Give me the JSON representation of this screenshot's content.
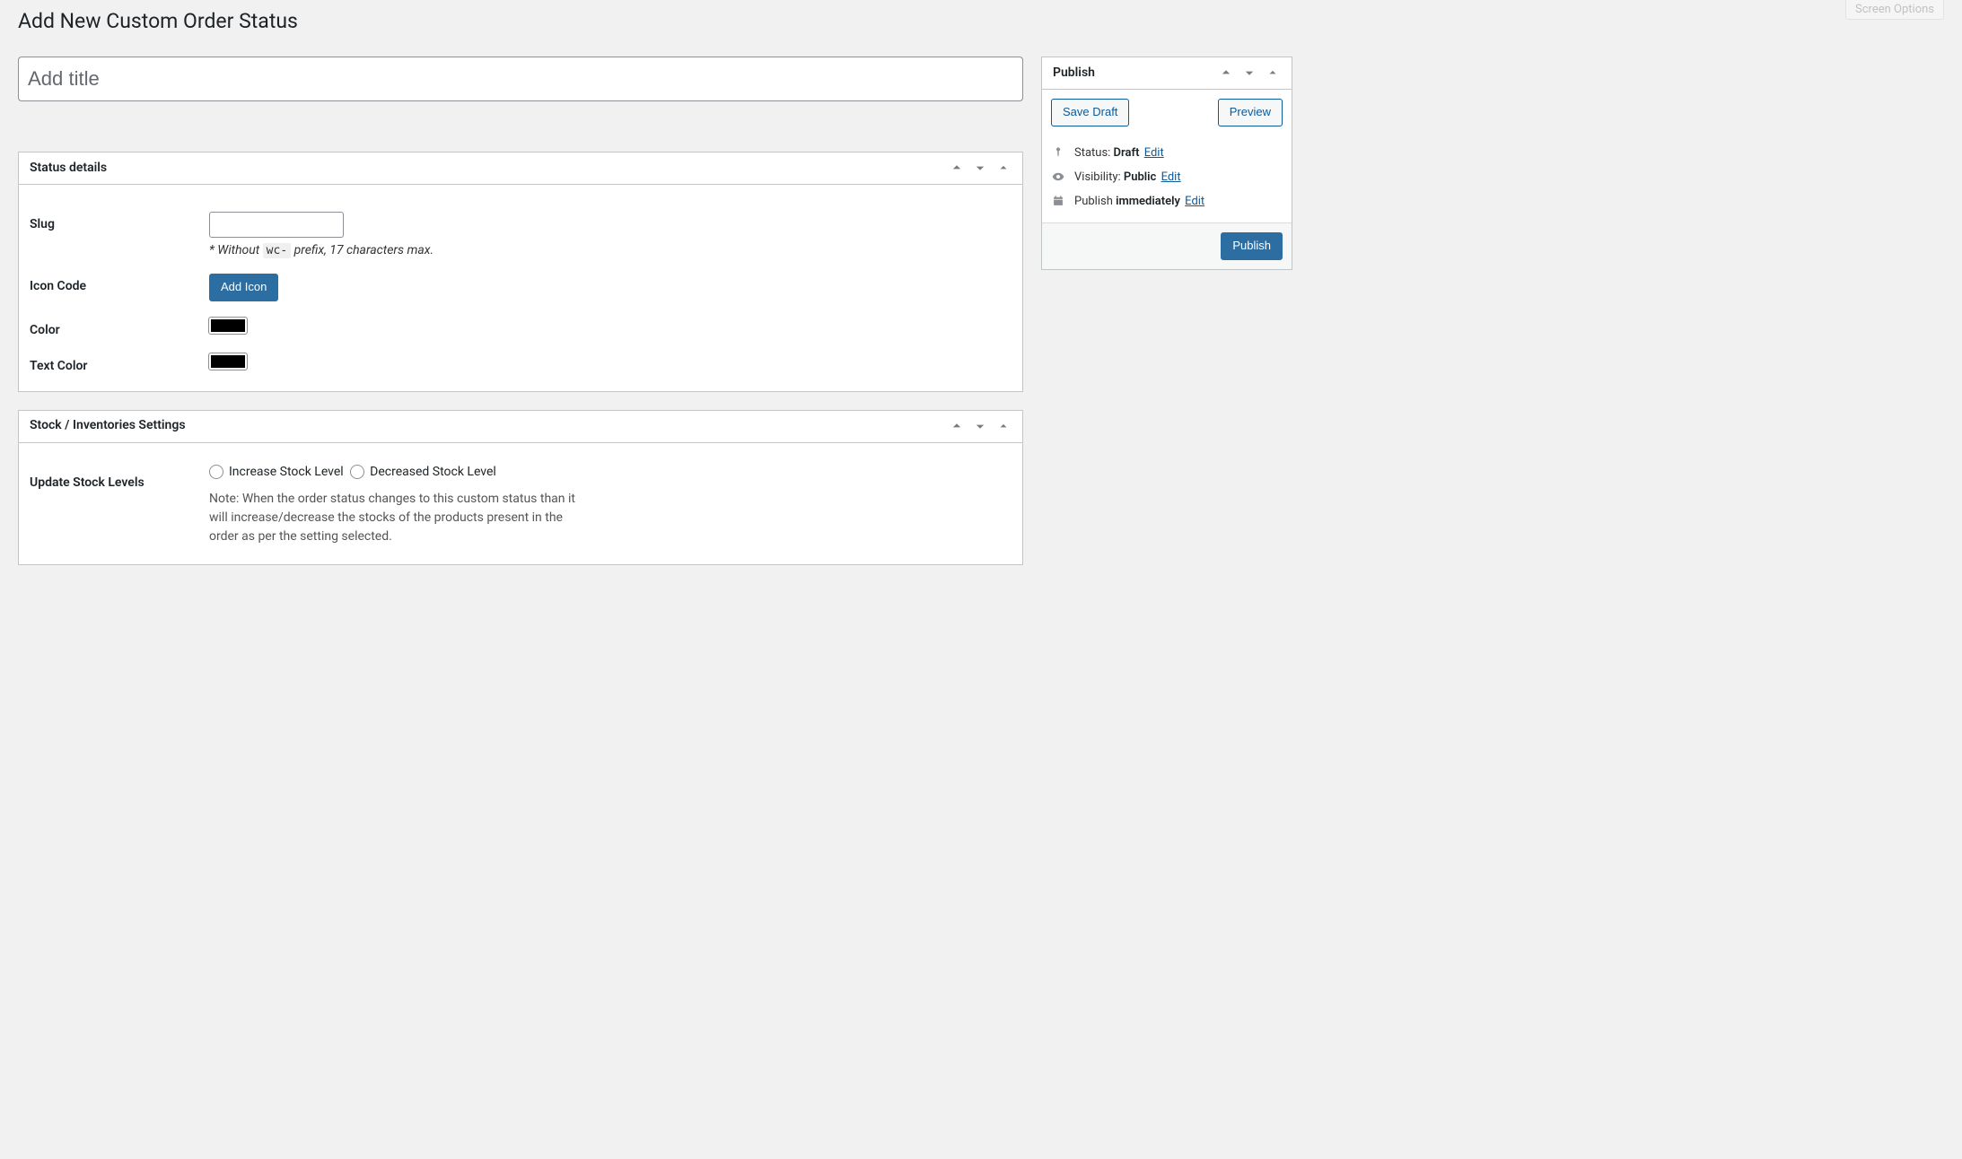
{
  "screen_options": {
    "label": "Screen Options"
  },
  "page": {
    "title": "Add New Custom Order Status"
  },
  "title_input": {
    "placeholder": "Add title",
    "value": ""
  },
  "status_details": {
    "heading": "Status details",
    "slug": {
      "label": "Slug",
      "value": "",
      "hint_prefix": "* Without ",
      "hint_code": "wc-",
      "hint_suffix": " prefix, 17 characters max."
    },
    "icon_code": {
      "label": "Icon Code",
      "button": "Add Icon"
    },
    "color": {
      "label": "Color",
      "value": "#000000"
    },
    "text_color": {
      "label": "Text Color",
      "value": "#000000"
    }
  },
  "stock": {
    "heading": "Stock / Inventories Settings",
    "update_levels": {
      "label": "Update Stock Levels",
      "option_increase": "Increase Stock Level",
      "option_decrease": "Decreased Stock Level",
      "note": "Note: When the order status changes to this custom status than it will increase/decrease the stocks of the products present in the order as per the setting selected."
    }
  },
  "publish": {
    "heading": "Publish",
    "save_draft": "Save Draft",
    "preview": "Preview",
    "status_label": "Status: ",
    "status_value": "Draft",
    "visibility_label": "Visibility: ",
    "visibility_value": "Public",
    "schedule_label": "Publish ",
    "schedule_value": "immediately",
    "edit": "Edit",
    "publish_button": "Publish"
  }
}
